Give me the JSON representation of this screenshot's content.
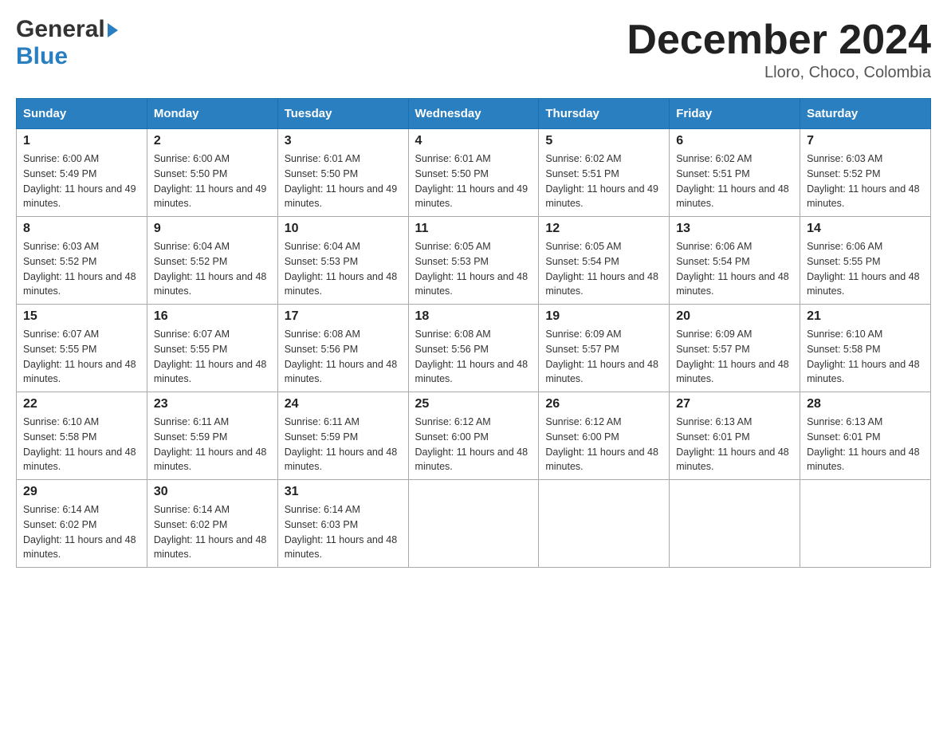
{
  "header": {
    "month_title": "December 2024",
    "location": "Lloro, Choco, Colombia",
    "logo_general": "General",
    "logo_blue": "Blue"
  },
  "days_of_week": [
    "Sunday",
    "Monday",
    "Tuesday",
    "Wednesday",
    "Thursday",
    "Friday",
    "Saturday"
  ],
  "weeks": [
    [
      {
        "num": "1",
        "sunrise": "6:00 AM",
        "sunset": "5:49 PM",
        "daylight": "11 hours and 49 minutes."
      },
      {
        "num": "2",
        "sunrise": "6:00 AM",
        "sunset": "5:50 PM",
        "daylight": "11 hours and 49 minutes."
      },
      {
        "num": "3",
        "sunrise": "6:01 AM",
        "sunset": "5:50 PM",
        "daylight": "11 hours and 49 minutes."
      },
      {
        "num": "4",
        "sunrise": "6:01 AM",
        "sunset": "5:50 PM",
        "daylight": "11 hours and 49 minutes."
      },
      {
        "num": "5",
        "sunrise": "6:02 AM",
        "sunset": "5:51 PM",
        "daylight": "11 hours and 49 minutes."
      },
      {
        "num": "6",
        "sunrise": "6:02 AM",
        "sunset": "5:51 PM",
        "daylight": "11 hours and 48 minutes."
      },
      {
        "num": "7",
        "sunrise": "6:03 AM",
        "sunset": "5:52 PM",
        "daylight": "11 hours and 48 minutes."
      }
    ],
    [
      {
        "num": "8",
        "sunrise": "6:03 AM",
        "sunset": "5:52 PM",
        "daylight": "11 hours and 48 minutes."
      },
      {
        "num": "9",
        "sunrise": "6:04 AM",
        "sunset": "5:52 PM",
        "daylight": "11 hours and 48 minutes."
      },
      {
        "num": "10",
        "sunrise": "6:04 AM",
        "sunset": "5:53 PM",
        "daylight": "11 hours and 48 minutes."
      },
      {
        "num": "11",
        "sunrise": "6:05 AM",
        "sunset": "5:53 PM",
        "daylight": "11 hours and 48 minutes."
      },
      {
        "num": "12",
        "sunrise": "6:05 AM",
        "sunset": "5:54 PM",
        "daylight": "11 hours and 48 minutes."
      },
      {
        "num": "13",
        "sunrise": "6:06 AM",
        "sunset": "5:54 PM",
        "daylight": "11 hours and 48 minutes."
      },
      {
        "num": "14",
        "sunrise": "6:06 AM",
        "sunset": "5:55 PM",
        "daylight": "11 hours and 48 minutes."
      }
    ],
    [
      {
        "num": "15",
        "sunrise": "6:07 AM",
        "sunset": "5:55 PM",
        "daylight": "11 hours and 48 minutes."
      },
      {
        "num": "16",
        "sunrise": "6:07 AM",
        "sunset": "5:55 PM",
        "daylight": "11 hours and 48 minutes."
      },
      {
        "num": "17",
        "sunrise": "6:08 AM",
        "sunset": "5:56 PM",
        "daylight": "11 hours and 48 minutes."
      },
      {
        "num": "18",
        "sunrise": "6:08 AM",
        "sunset": "5:56 PM",
        "daylight": "11 hours and 48 minutes."
      },
      {
        "num": "19",
        "sunrise": "6:09 AM",
        "sunset": "5:57 PM",
        "daylight": "11 hours and 48 minutes."
      },
      {
        "num": "20",
        "sunrise": "6:09 AM",
        "sunset": "5:57 PM",
        "daylight": "11 hours and 48 minutes."
      },
      {
        "num": "21",
        "sunrise": "6:10 AM",
        "sunset": "5:58 PM",
        "daylight": "11 hours and 48 minutes."
      }
    ],
    [
      {
        "num": "22",
        "sunrise": "6:10 AM",
        "sunset": "5:58 PM",
        "daylight": "11 hours and 48 minutes."
      },
      {
        "num": "23",
        "sunrise": "6:11 AM",
        "sunset": "5:59 PM",
        "daylight": "11 hours and 48 minutes."
      },
      {
        "num": "24",
        "sunrise": "6:11 AM",
        "sunset": "5:59 PM",
        "daylight": "11 hours and 48 minutes."
      },
      {
        "num": "25",
        "sunrise": "6:12 AM",
        "sunset": "6:00 PM",
        "daylight": "11 hours and 48 minutes."
      },
      {
        "num": "26",
        "sunrise": "6:12 AM",
        "sunset": "6:00 PM",
        "daylight": "11 hours and 48 minutes."
      },
      {
        "num": "27",
        "sunrise": "6:13 AM",
        "sunset": "6:01 PM",
        "daylight": "11 hours and 48 minutes."
      },
      {
        "num": "28",
        "sunrise": "6:13 AM",
        "sunset": "6:01 PM",
        "daylight": "11 hours and 48 minutes."
      }
    ],
    [
      {
        "num": "29",
        "sunrise": "6:14 AM",
        "sunset": "6:02 PM",
        "daylight": "11 hours and 48 minutes."
      },
      {
        "num": "30",
        "sunrise": "6:14 AM",
        "sunset": "6:02 PM",
        "daylight": "11 hours and 48 minutes."
      },
      {
        "num": "31",
        "sunrise": "6:14 AM",
        "sunset": "6:03 PM",
        "daylight": "11 hours and 48 minutes."
      },
      null,
      null,
      null,
      null
    ]
  ]
}
